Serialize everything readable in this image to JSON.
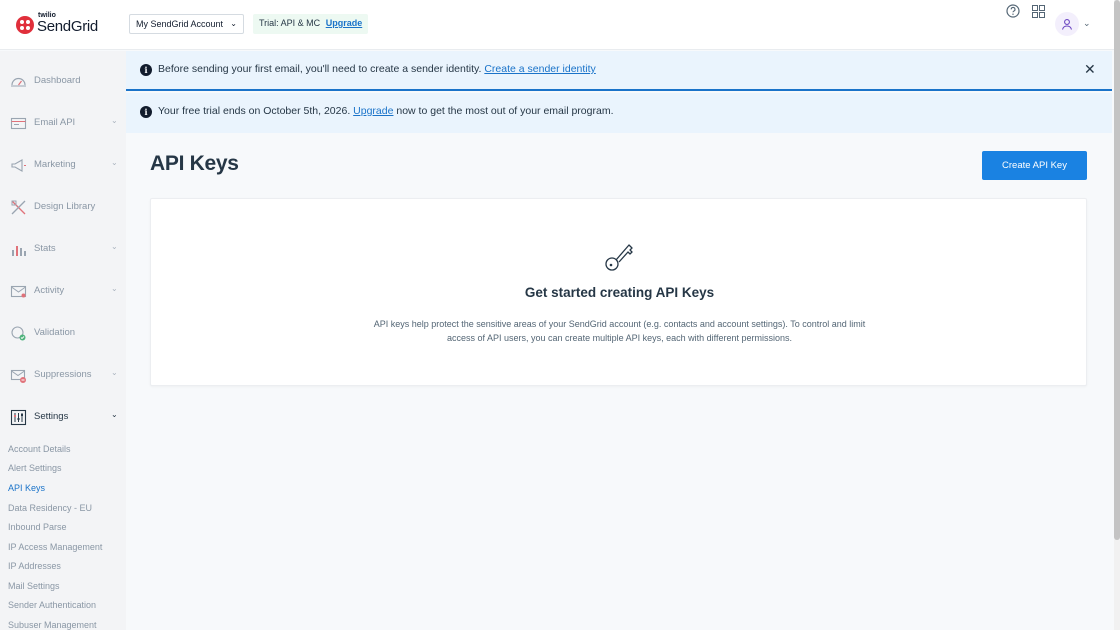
{
  "brand": {
    "small": "twilio",
    "name": "SendGrid"
  },
  "header": {
    "account_label": "My SendGrid Account",
    "trial_text": "Trial: API & MC",
    "upgrade_label": "Upgrade"
  },
  "sidebar": {
    "items": [
      {
        "label": "Dashboard",
        "icon": "dashboard-icon",
        "chevron": false
      },
      {
        "label": "Email API",
        "icon": "email-api-icon",
        "chevron": true
      },
      {
        "label": "Marketing",
        "icon": "megaphone-icon",
        "chevron": true
      },
      {
        "label": "Design Library",
        "icon": "design-tools-icon",
        "chevron": false
      },
      {
        "label": "Stats",
        "icon": "stats-icon",
        "chevron": true
      },
      {
        "label": "Activity",
        "icon": "activity-icon",
        "chevron": true
      },
      {
        "label": "Validation",
        "icon": "validation-icon",
        "chevron": false
      },
      {
        "label": "Suppressions",
        "icon": "suppressions-icon",
        "chevron": true
      },
      {
        "label": "Settings",
        "icon": "settings-icon",
        "chevron": true
      }
    ],
    "settings_sub": [
      "Account Details",
      "Alert Settings",
      "API Keys",
      "Data Residency - EU",
      "Inbound Parse",
      "IP Access Management",
      "IP Addresses",
      "Mail Settings",
      "Sender Authentication",
      "Subuser Management"
    ],
    "current": "API Keys"
  },
  "banners": {
    "sender": {
      "text": "Before sending your first email, you'll need to create a sender identity.",
      "link": "Create a sender identity"
    },
    "trial": {
      "pre": "Your free trial ends on October 5th, 2026.",
      "link": "Upgrade",
      "post": "now to get the most out of your email program."
    }
  },
  "main": {
    "title": "API Keys",
    "create_button": "Create API Key",
    "empty_title": "Get started creating API Keys",
    "empty_desc": "API keys help protect the sensitive areas of your SendGrid account (e.g. contacts and account settings). To control and limit access of API users, you can create multiple API keys, each with different permissions."
  },
  "colors": {
    "accent": "#1a82e2",
    "link": "#1a73c9",
    "brand_red": "#e02f3b",
    "banner_bg": "#eaf4fd"
  }
}
